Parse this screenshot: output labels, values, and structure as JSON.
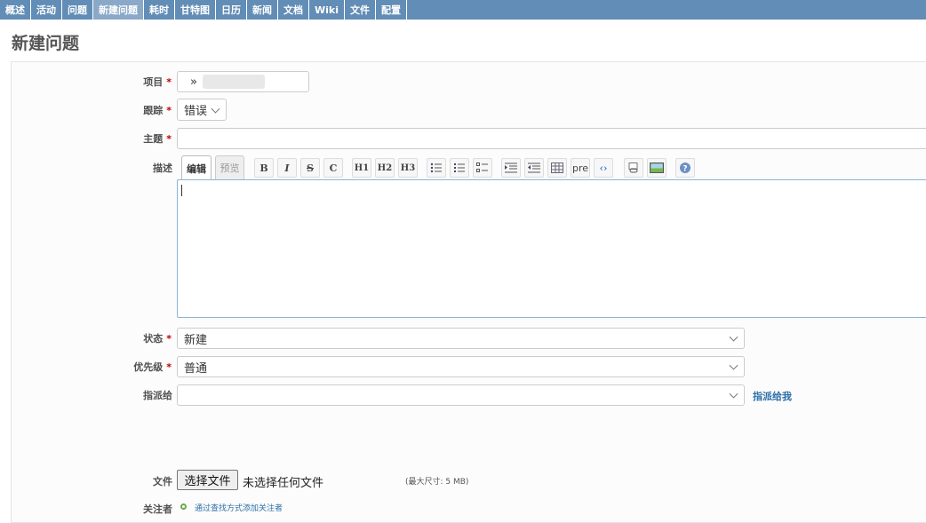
{
  "menu": {
    "tabs": [
      {
        "label": "概述"
      },
      {
        "label": "活动"
      },
      {
        "label": "问题"
      },
      {
        "label": "新建问题"
      },
      {
        "label": "耗时"
      },
      {
        "label": "甘特图"
      },
      {
        "label": "日历"
      },
      {
        "label": "新闻"
      },
      {
        "label": "文档"
      },
      {
        "label": "Wiki"
      },
      {
        "label": "文件"
      },
      {
        "label": "配置"
      }
    ],
    "selected_index": 3
  },
  "page": {
    "title": "新建问题"
  },
  "form": {
    "project": {
      "label": "项目",
      "required": "*",
      "value": "»"
    },
    "tracker": {
      "label": "跟踪",
      "required": "*",
      "value": "错误"
    },
    "subject": {
      "label": "主题",
      "required": "*",
      "value": ""
    },
    "description": {
      "label": "描述",
      "tab_edit": "编辑",
      "tab_preview": "预览",
      "toolbar": [
        "B",
        "I",
        "S",
        "C",
        "H1",
        "H2",
        "H3",
        "pre"
      ]
    },
    "status": {
      "label": "状态",
      "required": "*",
      "value": "新建"
    },
    "priority": {
      "label": "优先级",
      "required": "*",
      "value": "普通"
    },
    "assignee": {
      "label": "指派给",
      "value": "",
      "assign_to_me": "指派给我"
    },
    "files": {
      "label": "文件",
      "button": "选择文件",
      "no_file": "未选择任何文件",
      "max_size": "(最大尺寸: 5 MB)"
    },
    "watchers": {
      "label": "关注者",
      "search_link": "通过查找方式添加关注者"
    }
  },
  "colors": {
    "menu_bg": "#628db6",
    "selected_tab": "#8aa8c8",
    "link": "#2a6ea6",
    "required": "#bb0000"
  }
}
